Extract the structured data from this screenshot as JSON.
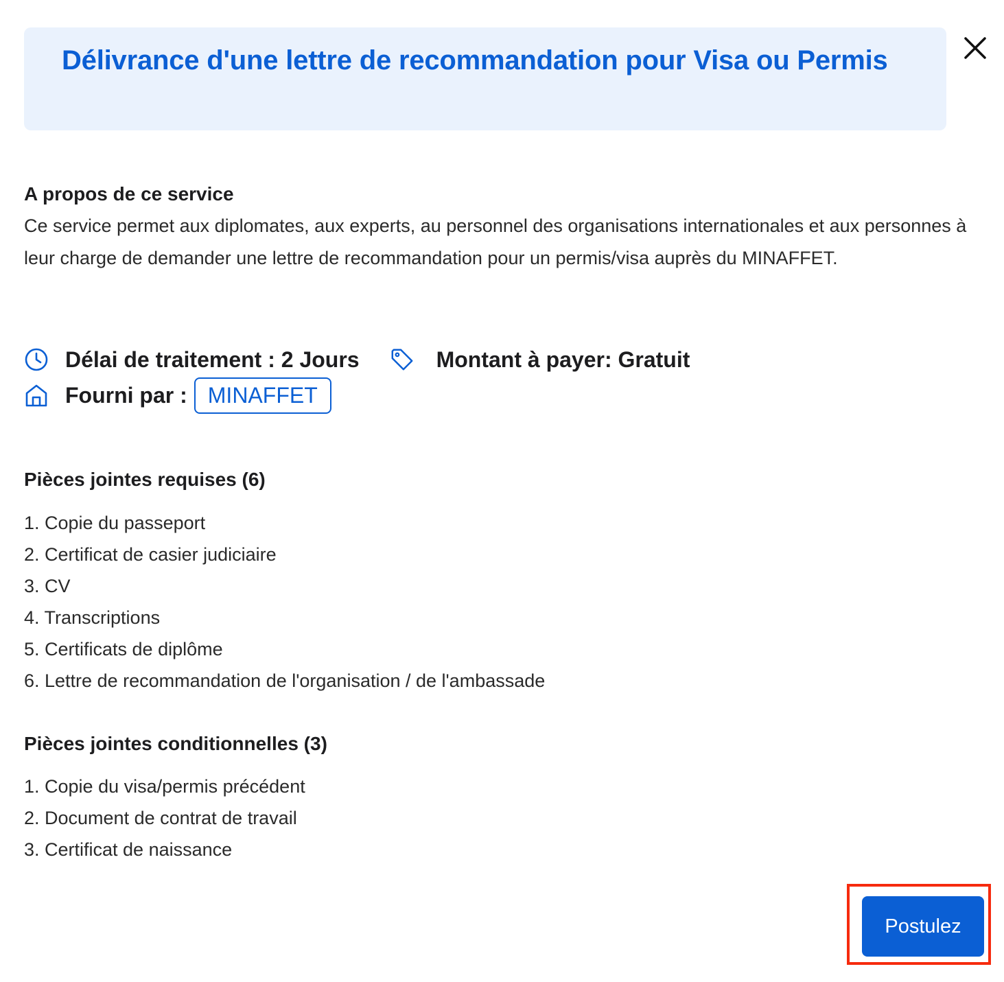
{
  "header": {
    "title": "Délivrance d'une lettre de recommandation pour Visa ou Permis",
    "close_icon": "close-icon"
  },
  "about": {
    "heading": "A propos de ce service",
    "text": "Ce service permet aux diplomates, aux experts, au personnel des organisations internationales et aux personnes à leur charge de demander une lettre de recommandation pour un permis/visa auprès du MINAFFET."
  },
  "meta": {
    "delay_icon": "clock-icon",
    "delay_label": "Délai de traitement : 2 Jours",
    "amount_icon": "tag-icon",
    "amount_label": "Montant à payer: Gratuit",
    "provider_icon": "home-icon",
    "provider_label": "Fourni par :",
    "provider_name": "MINAFFET"
  },
  "required": {
    "heading": "Pièces jointes requises (6)",
    "items": [
      "1. Copie du passeport",
      "2. Certificat de casier judiciaire",
      "3. CV",
      "4. Transcriptions",
      "5. Certificats de diplôme",
      "6. Lettre de recommandation de l'organisation / de l'ambassade"
    ]
  },
  "conditional": {
    "heading": "Pièces jointes conditionnelles (3)",
    "items": [
      "1. Copie du visa/permis précédent",
      "2. Document de contrat de travail",
      "3. Certificat de naissance"
    ]
  },
  "actions": {
    "apply_label": "Postulez"
  },
  "colors": {
    "accent": "#0b5fd4",
    "header_bg": "#eaf2fd",
    "highlight": "#f62b0e"
  }
}
